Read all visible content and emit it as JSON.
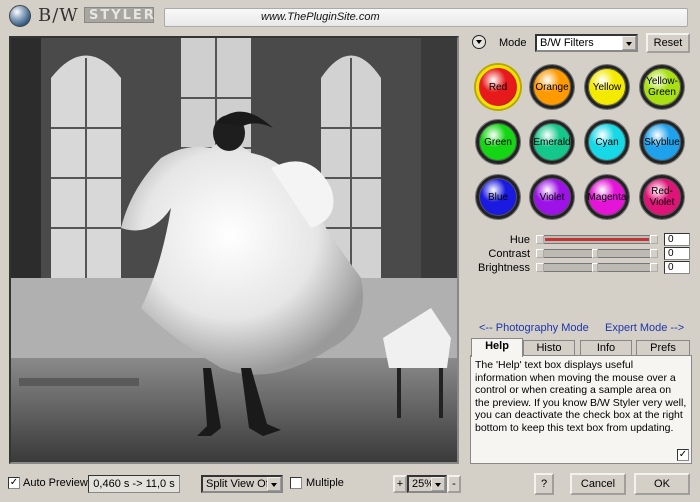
{
  "header": {
    "logo_bw": "B/W",
    "logo_styler": "STYLER",
    "url": "www.ThePluginSite.com"
  },
  "mode": {
    "label": "Mode",
    "selected": "B/W Filters",
    "reset_label": "Reset"
  },
  "swatches": [
    {
      "label": "Red",
      "color": "#e61a1a",
      "selected": true
    },
    {
      "label": "Orange",
      "color": "#ff9a00"
    },
    {
      "label": "Yellow",
      "color": "#f4ea00"
    },
    {
      "label": "Yellow-Green",
      "color": "#a8e014"
    },
    {
      "label": "Green",
      "color": "#14d614"
    },
    {
      "label": "Emerald",
      "color": "#14c88c"
    },
    {
      "label": "Cyan",
      "color": "#16d8e6"
    },
    {
      "label": "Skyblue",
      "color": "#1fa2ec"
    },
    {
      "label": "Blue",
      "color": "#1a1ae0"
    },
    {
      "label": "Violet",
      "color": "#9d12e6"
    },
    {
      "label": "Magenta",
      "color": "#e414d8"
    },
    {
      "label": "Red-Violet",
      "color": "#e01478"
    }
  ],
  "sliders": {
    "hue": {
      "label": "Hue",
      "value": "0"
    },
    "contrast": {
      "label": "Contrast",
      "value": "0"
    },
    "brightness": {
      "label": "Brightness",
      "value": "0"
    }
  },
  "links": {
    "photography": "<-- Photography Mode",
    "expert": "Expert Mode -->"
  },
  "tabs": {
    "help": "Help",
    "histo": "Histo",
    "info": "Info",
    "prefs": "Prefs"
  },
  "help_text": "The 'Help' text box displays useful information when moving the mouse over a control or when creating a sample area on the preview. If you know B/W Styler very well, you can deactivate the check box at the right bottom to keep this text box from updating.",
  "bottom": {
    "auto_preview": "Auto Preview",
    "timing": "0,460 s -> 11,0 s",
    "split_view": "Split View Off",
    "multiple": "Multiple",
    "zoom_plus": "+",
    "zoom_minus": "-",
    "zoom": "25%",
    "help_btn": "?",
    "cancel": "Cancel",
    "ok": "OK"
  },
  "check_mark": "✓"
}
